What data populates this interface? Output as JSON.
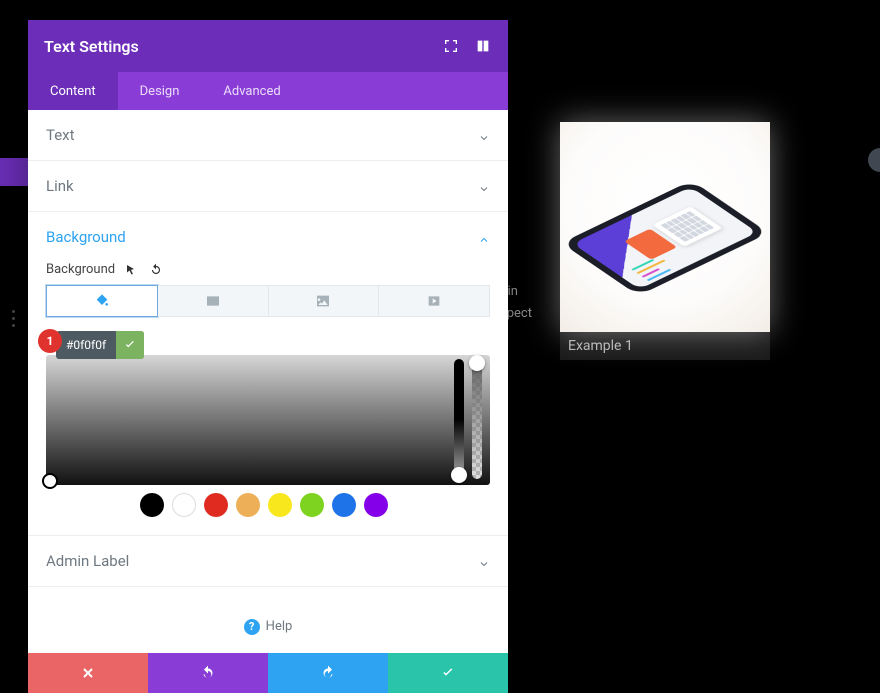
{
  "panel": {
    "title": "Text Settings",
    "tabs": {
      "content": "Content",
      "design": "Design",
      "advanced": "Advanced"
    },
    "sections": {
      "text": "Text",
      "link": "Link",
      "background": "Background",
      "admin": "Admin Label"
    },
    "bg_label": "Background",
    "hex_value": "#0f0f0f",
    "step_badge": "1",
    "help": "Help"
  },
  "swatches": [
    "#000000",
    "#ffffff",
    "#e02b20",
    "#edb059",
    "#f8e71c",
    "#7ed321",
    "#1e73e8",
    "#8300e9"
  ],
  "preview": {
    "caption": "Example 1"
  },
  "bg_fragments": {
    "a": "r in",
    "b": "spect"
  }
}
